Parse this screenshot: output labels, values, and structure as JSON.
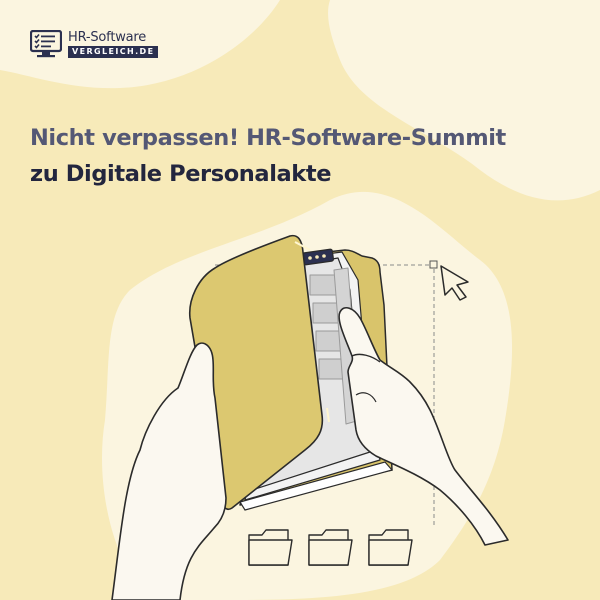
{
  "logo": {
    "line1": "HR-Software",
    "line2": "VERGLEICH.DE",
    "icon": "checklist-monitor-icon"
  },
  "headline": {
    "line1": "Nicht verpassen! HR-Software-Summit",
    "line2": "zu Digitale Personalakte"
  },
  "colors": {
    "background": "#f7eab9",
    "blob": "#fbf5e0",
    "folder": "#d9c46b",
    "ink": "#2b3050",
    "heading_muted": "#545875",
    "heading_dark": "#23263e"
  },
  "illustration": {
    "main": "hands-holding-folder-illustration",
    "cursor": "mouse-pointer-icon",
    "small_folders": [
      "folder-icon",
      "folder-icon",
      "folder-icon"
    ]
  }
}
